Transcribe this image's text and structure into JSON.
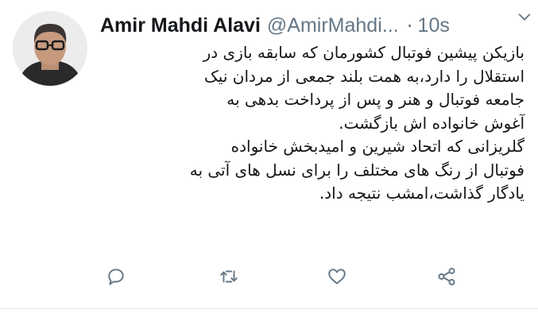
{
  "tweet": {
    "author_name": "Amir Mahdi Alavi",
    "handle": "@AmirMahdi...",
    "separator": "·",
    "time": "10s",
    "text_lines": [
      "بازیکن پیشین فوتبال کشورمان که سابقه بازی در",
      "استقلال را دارد،به همت بلند جمعی از مردان نیک",
      "جامعه فوتبال و هنر و پس از پرداخت بدهی به",
      "آغوش خانواده اش بازگشت.",
      "گلریزانی که اتحاد شیرین و امیدبخش خانواده",
      "فوتبال از رنگ های مختلف را برای نسل های آتی به",
      "یادگار گذاشت،امشب نتیجه داد."
    ]
  },
  "icons": {
    "menu": "chevron-down-icon",
    "reply": "reply-icon",
    "retweet": "retweet-icon",
    "like": "heart-icon",
    "share": "share-icon"
  },
  "colors": {
    "name": "#14171a",
    "secondary": "#657786",
    "icon": "#657786"
  }
}
